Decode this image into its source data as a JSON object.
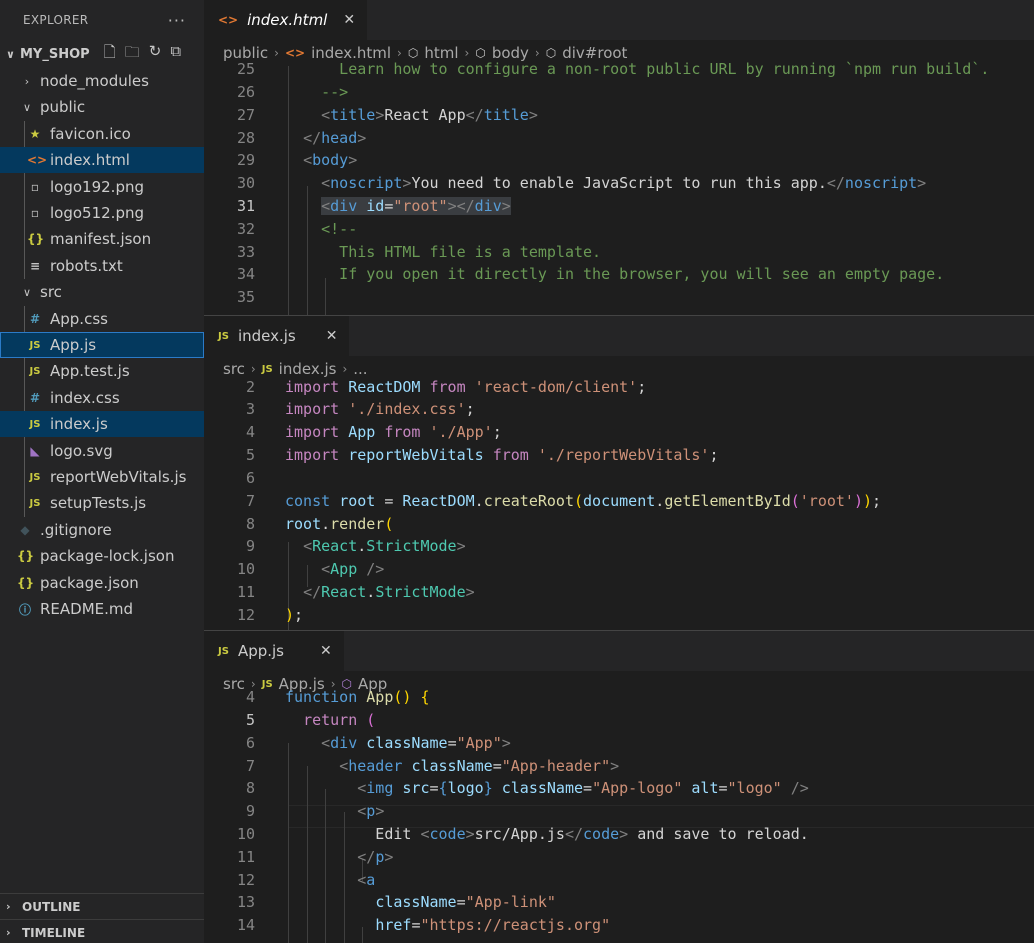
{
  "sidebar": {
    "title": "EXPLORER",
    "more": "···",
    "project": "MY_SHOP",
    "items": [
      {
        "label": "node_modules",
        "type": "folder",
        "open": false
      },
      {
        "label": "public",
        "type": "folder",
        "open": true
      },
      {
        "label": "favicon.ico",
        "type": "star"
      },
      {
        "label": "index.html",
        "type": "html"
      },
      {
        "label": "logo192.png",
        "type": "png"
      },
      {
        "label": "logo512.png",
        "type": "png"
      },
      {
        "label": "manifest.json",
        "type": "json"
      },
      {
        "label": "robots.txt",
        "type": "txt"
      },
      {
        "label": "src",
        "type": "folder",
        "open": true
      },
      {
        "label": "App.css",
        "type": "css"
      },
      {
        "label": "App.js",
        "type": "js"
      },
      {
        "label": "App.test.js",
        "type": "js"
      },
      {
        "label": "index.css",
        "type": "css"
      },
      {
        "label": "index.js",
        "type": "js"
      },
      {
        "label": "logo.svg",
        "type": "svg"
      },
      {
        "label": "reportWebVitals.js",
        "type": "js"
      },
      {
        "label": "setupTests.js",
        "type": "js"
      },
      {
        "label": ".gitignore",
        "type": "git"
      },
      {
        "label": "package-lock.json",
        "type": "json"
      },
      {
        "label": "package.json",
        "type": "json"
      },
      {
        "label": "README.md",
        "type": "info"
      }
    ],
    "outline": "OUTLINE",
    "timeline": "TIMELINE"
  },
  "editor1": {
    "tab": "index.html",
    "crumbs": [
      "public",
      "index.html",
      "html",
      "body",
      "div#root"
    ]
  },
  "editor2": {
    "tab": "index.js",
    "crumbs": [
      "src",
      "index.js",
      "..."
    ]
  },
  "editor3": {
    "tab": "App.js",
    "crumbs": [
      "src",
      "App.js",
      "App"
    ]
  },
  "colors": {
    "accent": "#007acc",
    "selection": "#04395e"
  }
}
